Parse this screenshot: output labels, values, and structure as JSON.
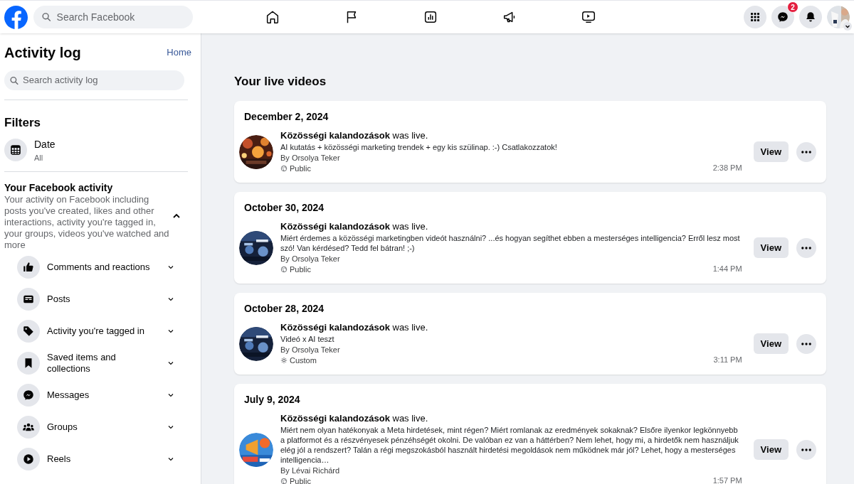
{
  "topbar": {
    "search": {
      "placeholder": "Search Facebook"
    },
    "nav": [
      {
        "kind": "home"
      },
      {
        "kind": "flag"
      },
      {
        "kind": "chart"
      },
      {
        "kind": "megaphone"
      },
      {
        "kind": "video"
      }
    ],
    "actions": [
      {
        "kind": "menu"
      },
      {
        "kind": "messenger",
        "badge": "2"
      },
      {
        "kind": "bell"
      }
    ]
  },
  "sidebar": {
    "title": "Activity log",
    "home_link": "Home",
    "search": {
      "placeholder": "Search activity log"
    },
    "filters_title": "Filters",
    "filter": {
      "label": "Date",
      "value": "All"
    },
    "section": {
      "title": "Your Facebook activity",
      "description": "Your activity on Facebook including posts you've created, likes and other interactions, activity you're tagged in, your groups, videos you've watched and more",
      "expanded": true,
      "items": [
        {
          "kind": "like",
          "label": "Comments and reactions",
          "expanded": false
        },
        {
          "kind": "posts",
          "label": "Posts",
          "expanded": false
        },
        {
          "kind": "tag",
          "label": "Activity you're tagged in",
          "expanded": false
        },
        {
          "kind": "bookmark",
          "label": "Saved items and collections",
          "expanded": false
        },
        {
          "kind": "messenger",
          "label": "Messages",
          "expanded": false
        },
        {
          "kind": "groups",
          "label": "Groups",
          "expanded": false
        },
        {
          "kind": "reels",
          "label": "Reels",
          "expanded": false
        }
      ]
    }
  },
  "main": {
    "title": "Your live videos",
    "entries": [
      {
        "date": "December 2, 2024",
        "page": "Közösségi kalandozások",
        "action": "was live.",
        "description": "AI kutatás + közösségi marketing trendek + egy kis szülinap. :-) Csatlakozzatok!",
        "author": "By Orsolya Teker",
        "audience": {
          "kind": "public",
          "label": "Public"
        },
        "time": "2:38 PM",
        "button": "View"
      },
      {
        "date": "October 30, 2024",
        "page": "Közösségi kalandozások",
        "action": "was live.",
        "description": "Miért érdemes a közösségi marketingben videót használni? ...és hogyan segíthet ebben a mesterséges intelligencia? Erről lesz most szó! Van kérdésed? Tedd fel bátran! ;-)",
        "author": "By Orsolya Teker",
        "audience": {
          "kind": "public",
          "label": "Public"
        },
        "time": "1:44 PM",
        "button": "View"
      },
      {
        "date": "October 28, 2024",
        "page": "Közösségi kalandozások",
        "action": "was live.",
        "description": "Videó x AI teszt",
        "author": "By Orsolya Teker",
        "audience": {
          "kind": "custom",
          "label": "Custom"
        },
        "time": "3:11 PM",
        "button": "View"
      },
      {
        "date": "July 9, 2024",
        "page": "Közösségi kalandozások",
        "action": "was live.",
        "description": "Miért nem olyan hatékonyak a Meta hirdetések, mint régen? Miért romlanak az eredmények sokaknak? Elsőre ilyenkor legkönnyebb a platformot és a részvényesek pénzéhségét okolni. De valóban ez van a háttérben? Nem lehet, hogy mi, a hirdetők nem használjuk elég jól a rendszert? Talán a régi megszokásból használt hirdetési megoldások nem működnek már jól? Lehet, hogy a mesterséges intelligencia…",
        "author": "By Lévai Richárd",
        "audience": {
          "kind": "public",
          "label": "Public"
        },
        "time": "1:57 PM",
        "button": "View"
      }
    ]
  }
}
